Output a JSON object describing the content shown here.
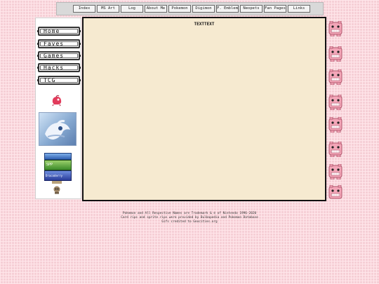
{
  "nav": {
    "items": [
      {
        "label": "Index"
      },
      {
        "label": "MS Art"
      },
      {
        "label": "Log"
      },
      {
        "label": "About Me"
      },
      {
        "label": "Pokemon"
      },
      {
        "label": "Digimon"
      },
      {
        "label": "F. Emblem"
      },
      {
        "label": "Neopets"
      },
      {
        "label": "Fan Pages"
      },
      {
        "label": "Links"
      }
    ]
  },
  "sidebar": {
    "items": [
      {
        "label": "Home"
      },
      {
        "label": "Faves"
      },
      {
        "label": "Games"
      },
      {
        "label": "Hacks"
      },
      {
        "label": "TCG"
      }
    ],
    "badges": [
      "SPP",
      "Dracoderry"
    ]
  },
  "content": {
    "title": "TEXTTEXT"
  },
  "footer": {
    "line1": "Pokemon and All Respective Names are Trademark & © of Nintendo 1996-2020",
    "line2": "Card rips and sprite rips were provided by Bulbapedia and Pokemon Database",
    "line3": "Gifs credited to Geocities.org"
  },
  "colors": {
    "background": "#f6cfd6",
    "content_bg": "#f6ead0",
    "monster_pink": "#f3a6b8"
  }
}
